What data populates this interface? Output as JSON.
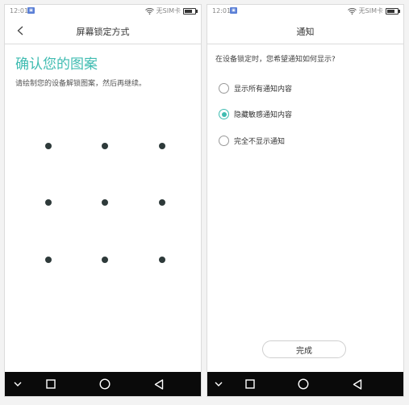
{
  "left_screen": {
    "status": {
      "time": "12:01",
      "carrier": "无SIM卡"
    },
    "title": "屏幕锁定方式",
    "heading": "确认您的图案",
    "instruction": "请绘制您的设备解锁图案，然后再继续。",
    "icons": {
      "back": "chevron-left-icon",
      "wifi": "wifi-icon",
      "battery": "battery-icon"
    }
  },
  "right_screen": {
    "status": {
      "time": "12:01",
      "carrier": "无SIM卡"
    },
    "title": "通知",
    "question": "在设备锁定时，您希望通知如何显示?",
    "options": [
      {
        "label": "显示所有通知内容",
        "checked": false
      },
      {
        "label": "隐藏敏感通知内容",
        "checked": true
      },
      {
        "label": "完全不显示通知",
        "checked": false
      }
    ],
    "done_label": "完成"
  },
  "nav_bar": {
    "icons": [
      "chevron-down-icon",
      "square-icon",
      "circle-icon",
      "triangle-back-icon"
    ]
  },
  "colors": {
    "accent": "#3fbcb1",
    "nav_background": "#0a0a0a"
  }
}
